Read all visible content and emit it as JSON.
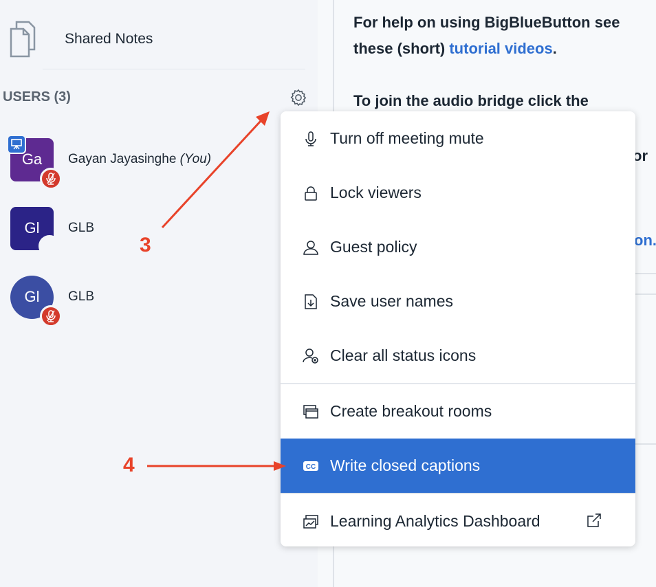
{
  "sidebar": {
    "shared_notes": "Shared Notes",
    "users_title": "USERS (3)",
    "users": [
      {
        "initials": "Ga",
        "name": "Gayan Jayasinghe",
        "suffix": "(You)",
        "color": "#5e2a91",
        "muted": true,
        "presenter": true
      },
      {
        "initials": "Gl",
        "name": "GLB",
        "color": "#2b2387",
        "muted": false
      },
      {
        "initials": "Gl",
        "name": "GLB",
        "color": "#3b4ea3",
        "muted": true
      }
    ]
  },
  "chat": {
    "line1": "For help on using BigBlueButton see these (short) ",
    "link": "tutorial videos",
    "line1_end": ".",
    "line2": "To join the audio bridge click the",
    "frag_or": "or",
    "frag_on": "on."
  },
  "menu": {
    "items": [
      {
        "label": "Turn off meeting mute",
        "icon": "microphone-icon"
      },
      {
        "label": "Lock viewers",
        "icon": "lock-icon"
      },
      {
        "label": "Guest policy",
        "icon": "user-icon"
      },
      {
        "label": "Save user names",
        "icon": "download-file-icon"
      },
      {
        "label": "Clear all status icons",
        "icon": "clear-status-icon"
      },
      {
        "label": "Create breakout rooms",
        "icon": "breakout-rooms-icon"
      },
      {
        "label": "Write closed captions",
        "icon": "closed-captions-icon",
        "active": true
      },
      {
        "label": "Learning Analytics Dashboard",
        "icon": "analytics-icon"
      }
    ]
  },
  "annotations": {
    "step3": "3",
    "step4": "4",
    "color": "#e8432a"
  },
  "colors": {
    "accent": "#2f6fd1",
    "mute": "#d33a2c"
  }
}
